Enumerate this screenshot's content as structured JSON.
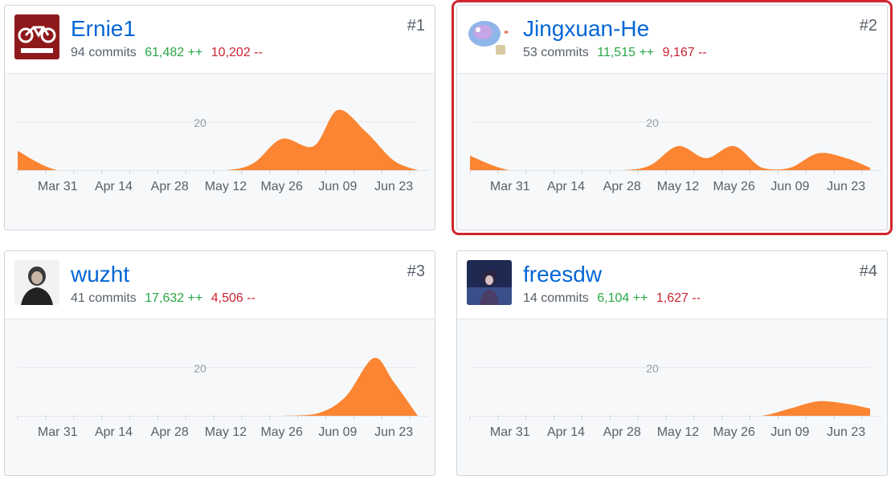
{
  "contributors": [
    {
      "rank": "#1",
      "username": "Ernie1",
      "commits": "94 commits",
      "additions": "61,482 ++",
      "deletions": "10,202 --",
      "avatar_icon": "motorcycle-logo-avatar",
      "highlighted": false
    },
    {
      "rank": "#2",
      "username": "Jingxuan-He",
      "commits": "53 commits",
      "additions": "11,515 ++",
      "deletions": "9,167 --",
      "avatar_icon": "cartoon-sticker-avatar",
      "highlighted": true
    },
    {
      "rank": "#3",
      "username": "wuzht",
      "commits": "41 commits",
      "additions": "17,632 ++",
      "deletions": "4,506 --",
      "avatar_icon": "person-photo-avatar",
      "highlighted": false
    },
    {
      "rank": "#4",
      "username": "freesdw",
      "commits": "14 commits",
      "additions": "6,104 ++",
      "deletions": "1,627 --",
      "avatar_icon": "anime-character-avatar",
      "highlighted": false
    }
  ],
  "colors": {
    "area": "#fb8532",
    "link": "#0366d6",
    "add": "#28a745",
    "del": "#cb2431",
    "highlight": "#d0262e"
  },
  "chart_data": [
    {
      "type": "area",
      "title": "Ernie1",
      "gridline_value": 20,
      "x_tick_labels": [
        "Mar 31",
        "Apr 14",
        "Apr 28",
        "May 12",
        "May 26",
        "Jun 09",
        "Jun 23"
      ],
      "x": [
        "Mar 21",
        "Mar 31",
        "Apr 14",
        "Apr 28",
        "May 12",
        "May 19",
        "May 26",
        "Jun 03",
        "Jun 09",
        "Jun 16",
        "Jun 23",
        "Jun 29"
      ],
      "values": [
        8,
        0,
        0,
        0,
        0,
        3,
        13,
        10,
        25,
        16,
        4,
        0
      ]
    },
    {
      "type": "area",
      "title": "Jingxuan-He",
      "gridline_value": 20,
      "x_tick_labels": [
        "Mar 31",
        "Apr 14",
        "Apr 28",
        "May 12",
        "May 26",
        "Jun 09",
        "Jun 23"
      ],
      "x": [
        "Mar 21",
        "Mar 31",
        "Apr 14",
        "Apr 28",
        "May 05",
        "May 12",
        "May 19",
        "May 26",
        "Jun 02",
        "Jun 09",
        "Jun 16",
        "Jun 23",
        "Jun 29"
      ],
      "values": [
        6,
        0,
        0,
        0,
        2,
        10,
        5,
        10,
        1,
        1,
        7,
        5,
        1
      ]
    },
    {
      "type": "area",
      "title": "wuzht",
      "gridline_value": 20,
      "x_tick_labels": [
        "Mar 31",
        "Apr 14",
        "Apr 28",
        "May 12",
        "May 26",
        "Jun 09",
        "Jun 23"
      ],
      "x": [
        "Mar 21",
        "Mar 31",
        "Apr 14",
        "Apr 28",
        "May 12",
        "May 26",
        "Jun 04",
        "Jun 11",
        "Jun 18",
        "Jun 23",
        "Jun 29"
      ],
      "values": [
        0,
        0,
        0,
        0,
        0,
        0,
        1,
        8,
        24,
        14,
        0
      ]
    },
    {
      "type": "area",
      "title": "freesdw",
      "gridline_value": 20,
      "x_tick_labels": [
        "Mar 31",
        "Apr 14",
        "Apr 28",
        "May 12",
        "May 26",
        "Jun 09",
        "Jun 23"
      ],
      "x": [
        "Mar 21",
        "Mar 31",
        "Apr 14",
        "Apr 28",
        "May 12",
        "May 26",
        "Jun 02",
        "Jun 09",
        "Jun 16",
        "Jun 23",
        "Jun 29"
      ],
      "values": [
        0,
        0,
        0,
        0,
        0,
        0,
        0,
        3,
        6,
        5,
        3
      ]
    }
  ]
}
